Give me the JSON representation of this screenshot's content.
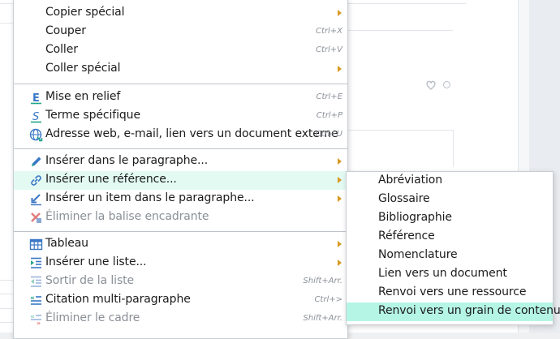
{
  "menu": {
    "items": [
      {
        "label": "Copier spécial",
        "shortcut": "",
        "submenu": true,
        "icon": "",
        "disabled": false
      },
      {
        "label": "Couper",
        "shortcut": "Ctrl+X",
        "submenu": false,
        "icon": "",
        "disabled": false
      },
      {
        "label": "Coller",
        "shortcut": "Ctrl+V",
        "submenu": false,
        "icon": "",
        "disabled": false
      },
      {
        "label": "Coller spécial",
        "shortcut": "",
        "submenu": true,
        "icon": "",
        "disabled": false
      },
      {
        "label": "Mise en relief",
        "shortcut": "Ctrl+E",
        "submenu": false,
        "icon": "emphasis-e-icon",
        "disabled": false
      },
      {
        "label": "Terme spécifique",
        "shortcut": "Ctrl+P",
        "submenu": false,
        "icon": "specific-term-s-icon",
        "disabled": false
      },
      {
        "label": "Adresse web, e-mail, lien vers un document externe",
        "shortcut": "Ctrl+U",
        "submenu": false,
        "icon": "globe-link-icon",
        "disabled": false
      },
      {
        "label": "Insérer dans le paragraphe...",
        "shortcut": "",
        "submenu": true,
        "icon": "pencil-icon",
        "disabled": false
      },
      {
        "label": "Insérer une référence...",
        "shortcut": "",
        "submenu": true,
        "icon": "chain-link-icon",
        "disabled": false,
        "highlighted": true
      },
      {
        "label": "Insérer un item dans le paragraphe...",
        "shortcut": "",
        "submenu": true,
        "icon": "insert-arrow-icon",
        "disabled": false
      },
      {
        "label": "Éliminer la balise encadrante",
        "shortcut": "",
        "submenu": false,
        "icon": "remove-tag-icon",
        "disabled": true
      },
      {
        "label": "Tableau",
        "shortcut": "",
        "submenu": true,
        "icon": "table-icon",
        "disabled": false
      },
      {
        "label": "Insérer une liste...",
        "shortcut": "",
        "submenu": true,
        "icon": "list-icon",
        "disabled": false
      },
      {
        "label": "Sortir de la liste",
        "shortcut": "Shift+Arr.",
        "submenu": false,
        "icon": "exit-list-icon",
        "disabled": true
      },
      {
        "label": "Citation multi-paragraphe",
        "shortcut": "Ctrl+>",
        "submenu": false,
        "icon": "quote-icon",
        "disabled": false
      },
      {
        "label": "Éliminer le cadre",
        "shortcut": "Shift+Arr.",
        "submenu": false,
        "icon": "remove-frame-icon",
        "disabled": true
      }
    ]
  },
  "submenu": {
    "items": [
      {
        "label": "Abréviation"
      },
      {
        "label": "Glossaire"
      },
      {
        "label": "Bibliographie"
      },
      {
        "label": "Référence"
      },
      {
        "label": "Nomenclature"
      },
      {
        "label": "Lien vers un document"
      },
      {
        "label": "Renvoi vers une ressource"
      },
      {
        "label": "Renvoi vers un grain de contenu",
        "active": true
      }
    ]
  },
  "colors": {
    "highlight_row": "#e3faf3",
    "active_submenu_row": "#b5f5e6",
    "submenu_arrow": "#d99a22",
    "icon_blue": "#3a78c6",
    "icon_green": "#1fa58a"
  }
}
